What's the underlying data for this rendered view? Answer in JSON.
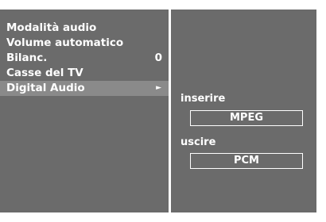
{
  "menu": {
    "items": [
      {
        "label": "Modalità audio",
        "value": ""
      },
      {
        "label": "Volume automatico",
        "value": ""
      },
      {
        "label": "Bilanc.",
        "value": "0"
      },
      {
        "label": "Casse del TV",
        "value": ""
      },
      {
        "label": "Digital Audio",
        "value": "",
        "arrow": "►"
      }
    ]
  },
  "submenu": {
    "input_label": "inserire",
    "input_value": "MPEG",
    "output_label": "uscire",
    "output_value": "PCM"
  },
  "colors": {
    "panel": "#6b6b6b",
    "selected": "#8a8a8a",
    "text": "#ffffff"
  }
}
